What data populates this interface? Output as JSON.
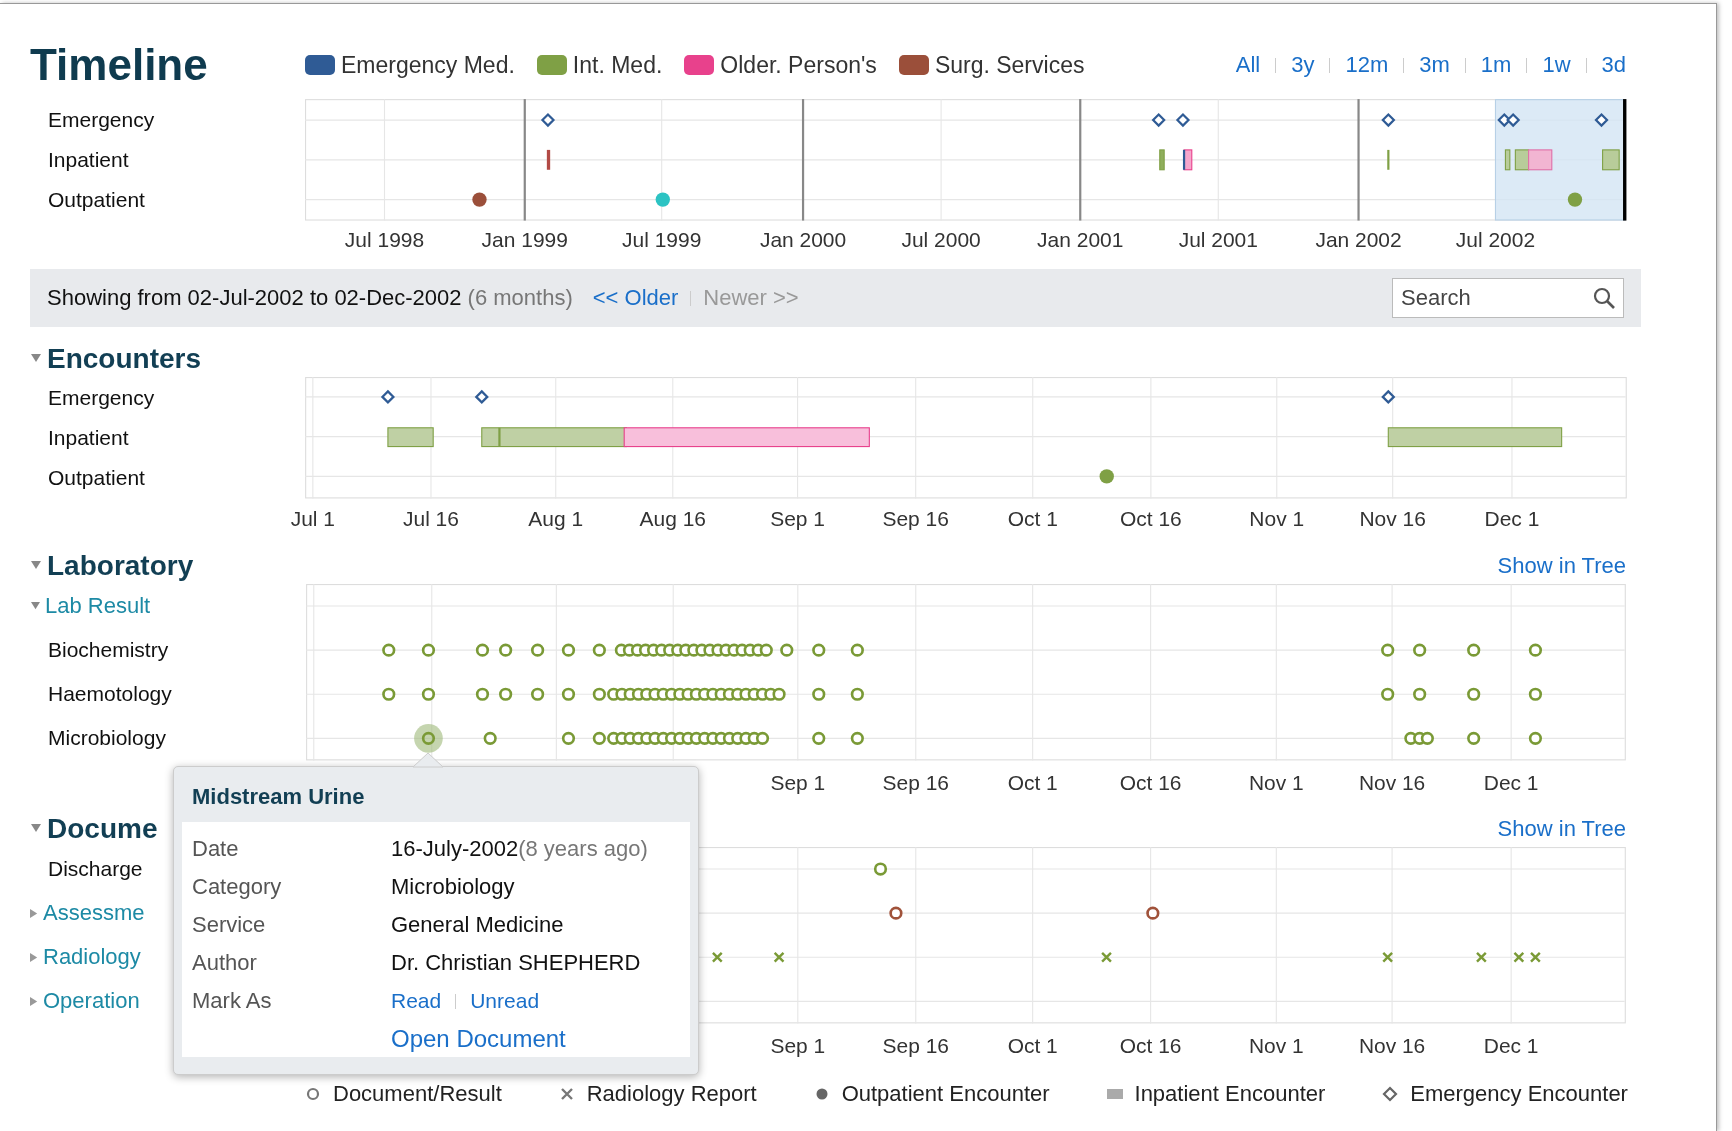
{
  "title": "Timeline",
  "legend": [
    {
      "label": "Emergency Med.",
      "color": "#2f5b95"
    },
    {
      "label": "Int. Med.",
      "color": "#7fa045"
    },
    {
      "label": "Older. Person's",
      "color": "#e8418c"
    },
    {
      "label": "Surg. Services",
      "color": "#9b4f3a"
    }
  ],
  "ranges": [
    "All",
    "3y",
    "12m",
    "3m",
    "1m",
    "1w",
    "3d"
  ],
  "overview": {
    "rows": [
      "Emergency",
      "Inpatient",
      "Outpatient"
    ],
    "ticks": [
      "Jul 1998",
      "Jan 1999",
      "Jul 1999",
      "Jan 2000",
      "Jul 2000",
      "Jan 2001",
      "Jul 2001",
      "Jan 2002",
      "Jul 2002"
    ]
  },
  "showing": {
    "text": "Showing from 02-Jul-2002 to 02-Dec-2002",
    "duration": "(6 months)",
    "older": "<< Older",
    "newer": "Newer >>",
    "newer_disabled": true,
    "search_placeholder": "Search"
  },
  "encounters": {
    "title": "Encounters",
    "expanded": true,
    "rows": [
      "Emergency",
      "Inpatient",
      "Outpatient"
    ],
    "ticks": [
      "Jul 1",
      "Jul 16",
      "Aug 1",
      "Aug 16",
      "Sep 1",
      "Sep 16",
      "Oct 1",
      "Oct 16",
      "Nov 1",
      "Nov 16",
      "Dec 1"
    ]
  },
  "laboratory": {
    "title": "Laboratory",
    "expanded": true,
    "link": "Show in Tree",
    "group": {
      "label": "Lab Result",
      "expanded": true
    },
    "rows": [
      "Biochemistry",
      "Haemotology",
      "Microbiology"
    ],
    "ticks": [
      "Sep 1",
      "Sep 16",
      "Oct 1",
      "Oct 16",
      "Nov 1",
      "Nov 16",
      "Dec 1"
    ]
  },
  "documents": {
    "title": "Docume",
    "expanded": true,
    "link": "Show in Tree",
    "rows": [
      {
        "label": "Discharge",
        "kind": "item"
      },
      {
        "label": "Assessme",
        "kind": "group",
        "expanded": false
      },
      {
        "label": "Radiology",
        "kind": "group",
        "expanded": false
      },
      {
        "label": "Operation",
        "kind": "group",
        "expanded": false
      }
    ],
    "ticks": [
      "Sep 1",
      "Sep 16",
      "Oct 1",
      "Oct 16",
      "Nov 1",
      "Nov 16",
      "Dec 1"
    ]
  },
  "key": [
    {
      "kind": "circle",
      "label": "Document/Result"
    },
    {
      "kind": "cross",
      "label": "Radiology Report"
    },
    {
      "kind": "dot",
      "label": "Outpatient Encounter"
    },
    {
      "kind": "bar",
      "label": "Inpatient Encounter"
    },
    {
      "kind": "diamond",
      "label": "Emergency Encounter"
    }
  ],
  "popup": {
    "title": "Midstream Urine",
    "fields": [
      {
        "label": "Date",
        "value": "16-July-2002",
        "note": "(8 years ago)"
      },
      {
        "label": "Category",
        "value": "Microbiology"
      },
      {
        "label": "Service",
        "value": "General Medicine"
      },
      {
        "label": "Author",
        "value": "Dr. Christian SHEPHERD"
      }
    ],
    "mark_as": {
      "label": "Mark As",
      "links": [
        "Read",
        "Unread"
      ]
    },
    "action": "Open Document"
  }
}
